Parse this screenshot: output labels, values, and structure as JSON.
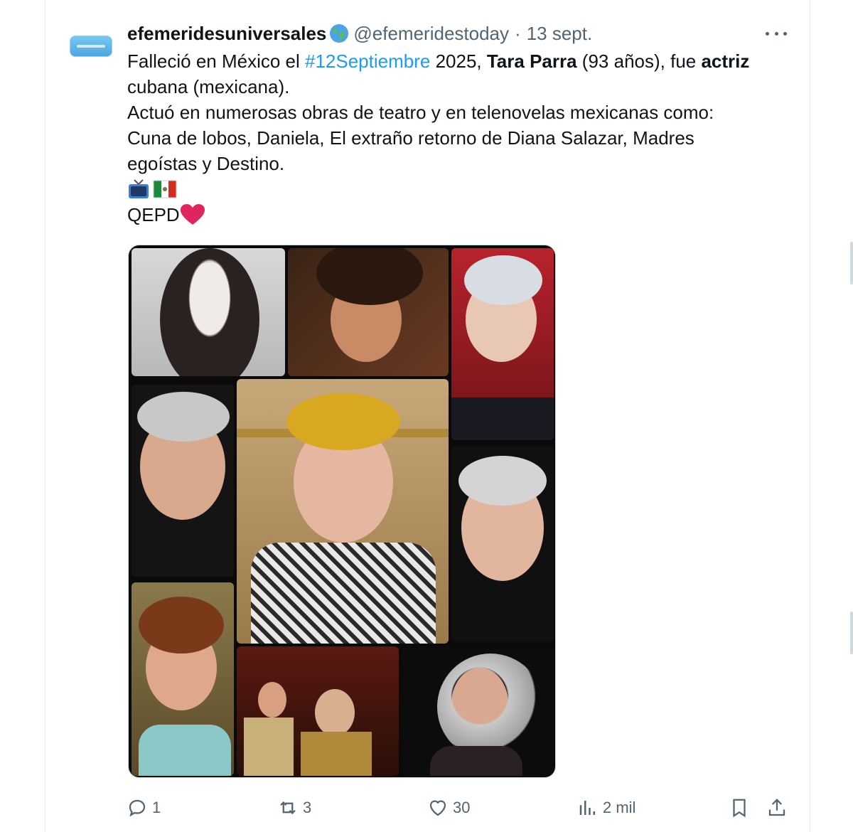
{
  "tweet": {
    "display_name": "efemeridesuniversales",
    "name_emoji": "globe-icon",
    "handle": "@efemeridestoday",
    "separator": "·",
    "date": "13 sept.",
    "more_label": "More",
    "body": {
      "l1_a": "Falleció en México el ",
      "l1_hashtag": "#12Septiembre",
      "l1_b": " 2025, ",
      "l1_name": "Tara Parra",
      "l1_c": " (93 años), fue ",
      "l1_role": "actriz",
      "l2": "cubana (mexicana).",
      "l3": "Actuó en numerosas obras de teatro y en telenovelas mexicanas como:",
      "l4": "Cuna de lobos, Daniela, El extraño retorno de Diana Salazar, Madres",
      "l5": "egoístas y Destino.",
      "emojis": [
        "tv-icon",
        "mexico-flag-icon"
      ],
      "qepd": "QEPD",
      "qepd_emoji": "red-heart-icon"
    },
    "media_alt": "Collage de fotos de Tara Parra"
  },
  "actions": {
    "reply_count": "1",
    "retweet_count": "3",
    "like_count": "30",
    "views_count": "2 mil"
  },
  "colors": {
    "text": "#0f1419",
    "secondary": "#536471",
    "link": "#1d9bf0",
    "heart": "#e0245e"
  }
}
